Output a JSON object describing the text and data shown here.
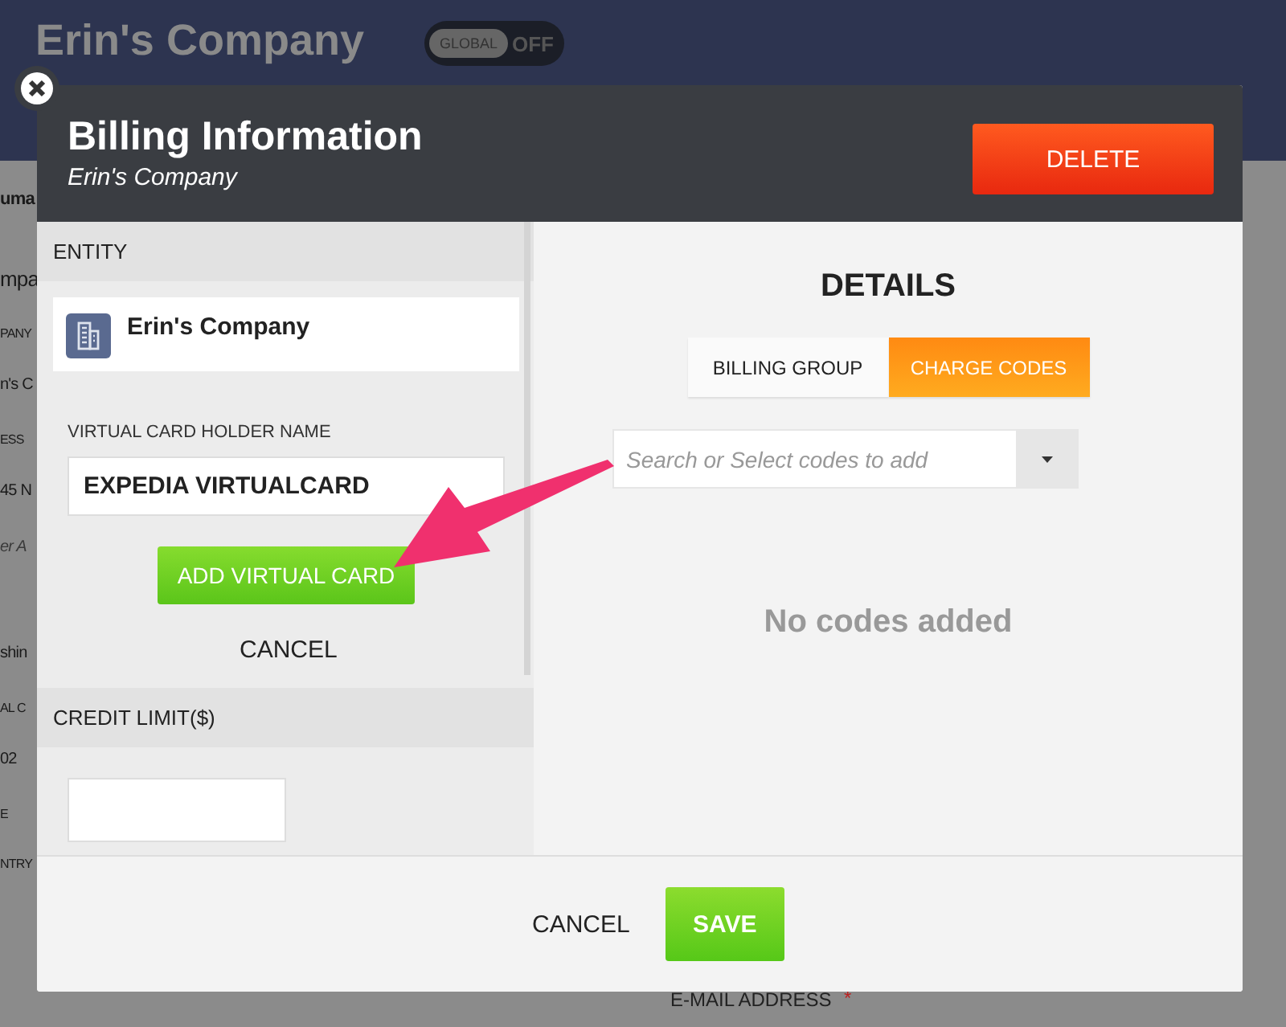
{
  "page": {
    "title": "Erin's Company",
    "toggle": {
      "label": "GLOBAL",
      "state": "OFF",
      "on": false
    },
    "left_fragments": [
      {
        "text": "uma",
        "kind": "heading"
      },
      {
        "text": "mpa",
        "kind": "title"
      },
      {
        "text": "PANY",
        "kind": "label"
      },
      {
        "text": "n's C",
        "kind": "value"
      },
      {
        "text": "ESS",
        "kind": "label"
      },
      {
        "text": "45 N",
        "kind": "value"
      },
      {
        "text": "er A",
        "kind": "placeholder"
      },
      {
        "text": "shin",
        "kind": "value"
      },
      {
        "text": "AL C",
        "kind": "label"
      },
      {
        "text": "02",
        "kind": "value"
      },
      {
        "text": "E",
        "kind": "label"
      },
      {
        "text": "NTRY",
        "kind": "label"
      }
    ],
    "email_label": "E-MAIL ADDRESS",
    "required_mark": "*"
  },
  "modal": {
    "title": "Billing Information",
    "subtitle": "Erin's Company",
    "delete_button": "DELETE",
    "entity": {
      "header": "ENTITY",
      "name": "Erin's Company"
    },
    "holder": {
      "label": "VIRTUAL CARD HOLDER NAME",
      "value": "EXPEDIA VIRTUALCARD"
    },
    "add_button": "ADD VIRTUAL CARD",
    "cancel_link": "CANCEL",
    "credit": {
      "header": "CREDIT LIMIT($)"
    },
    "details": {
      "title": "DETAILS",
      "tabs": [
        {
          "label": "BILLING GROUP",
          "selected": false
        },
        {
          "label": "CHARGE CODES",
          "selected": true
        }
      ],
      "search": {
        "placeholder": "Search or Select codes to add"
      },
      "empty_text": "No codes added"
    },
    "footer": {
      "cancel": "CANCEL",
      "save": "SAVE"
    }
  }
}
